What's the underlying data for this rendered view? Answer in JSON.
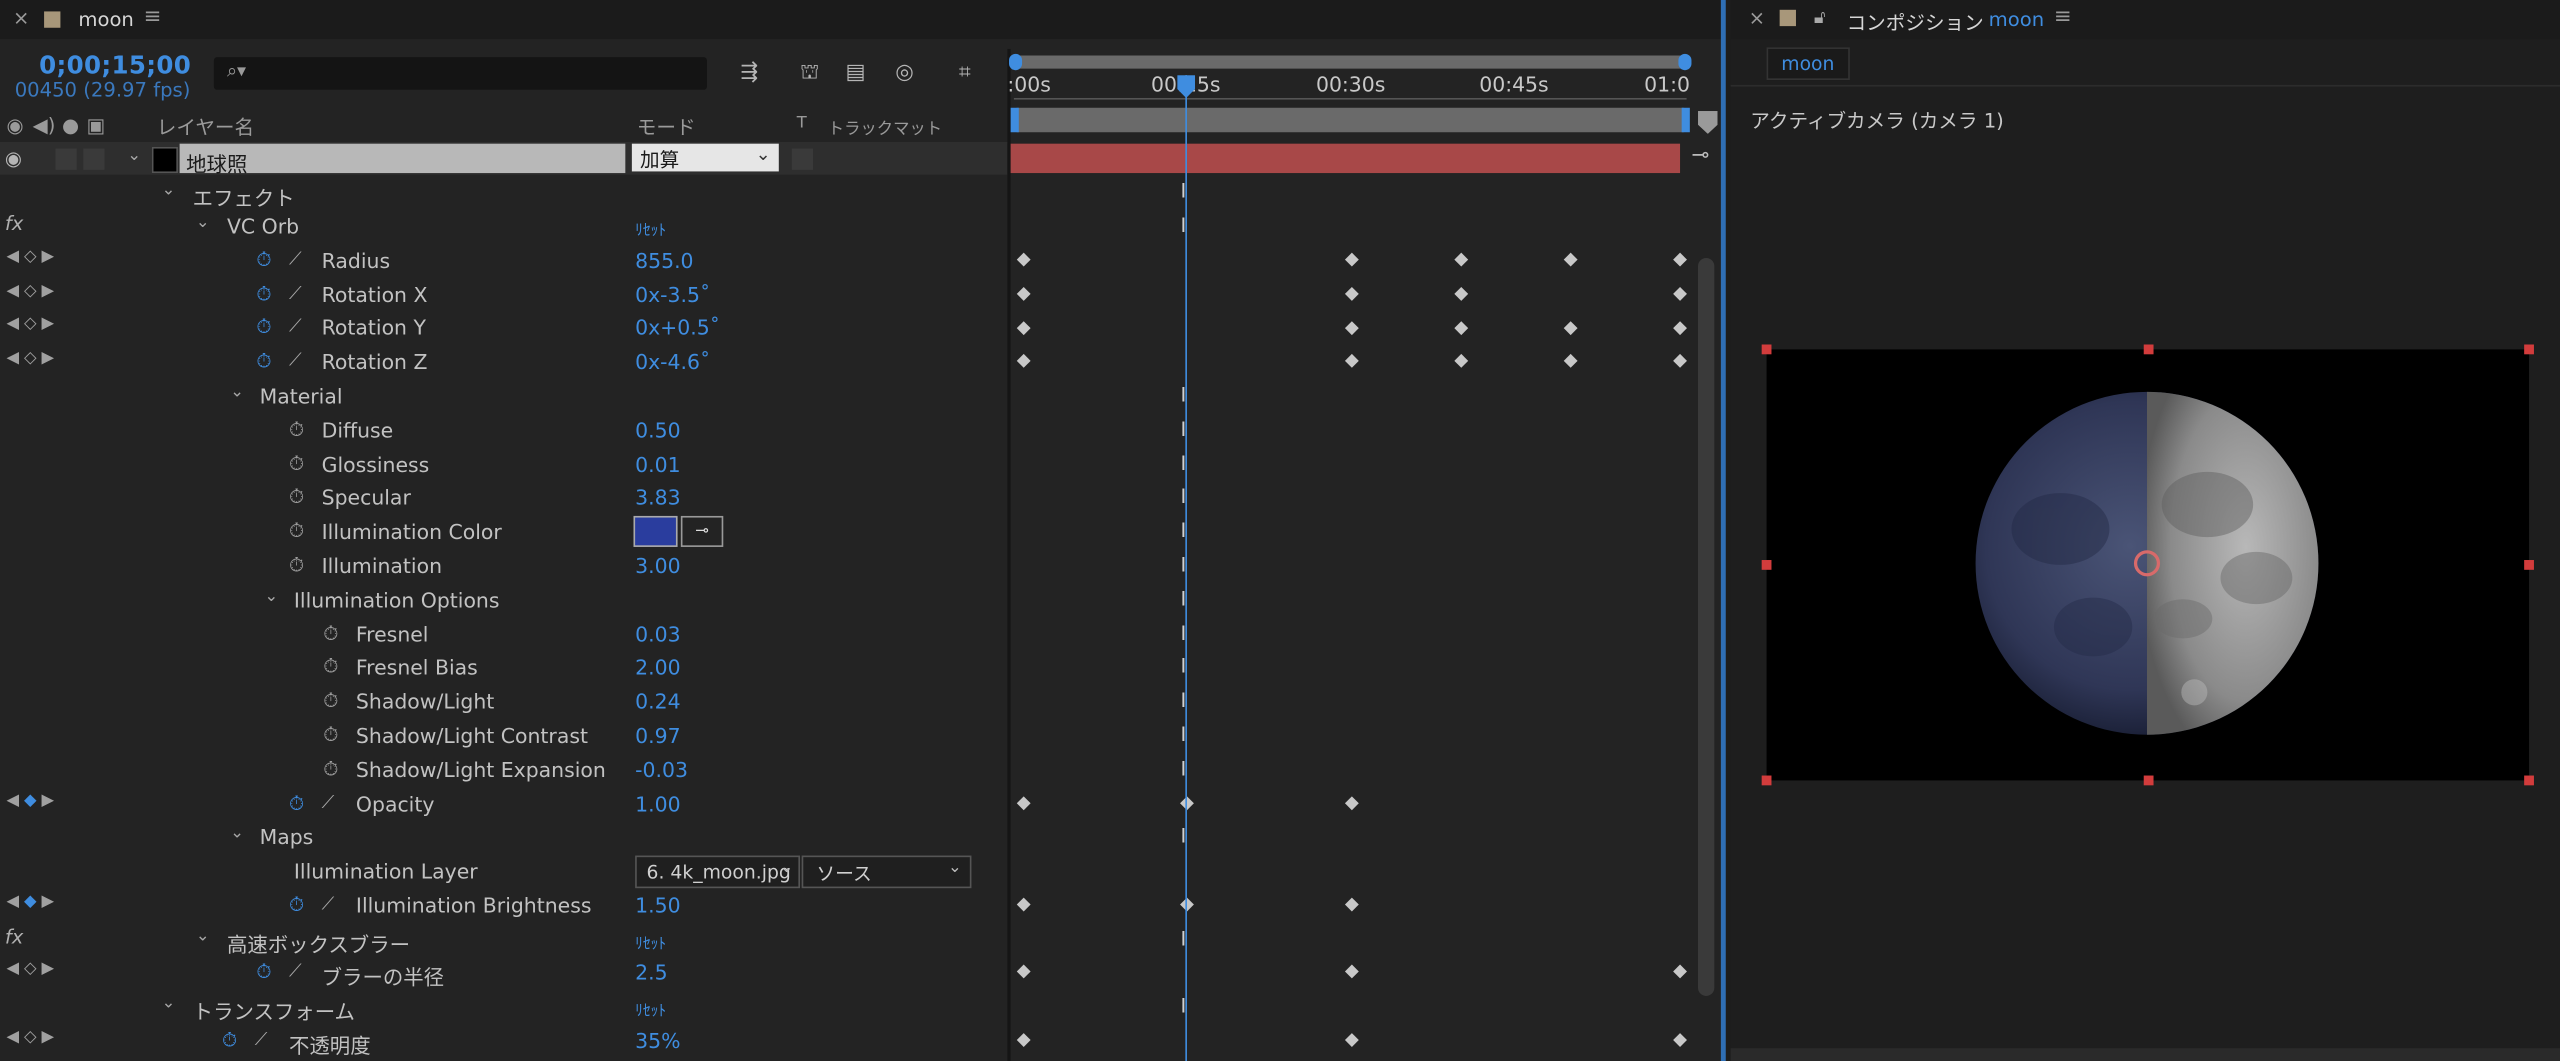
{
  "timeline": {
    "tab": {
      "title": "moon"
    },
    "timecode": "0;00;15;00",
    "frame_info": "00450 (29.97 fps)",
    "columns": {
      "layer_name": "レイヤー名",
      "mode": "モード",
      "t": "T",
      "track_matte": "トラックマット"
    },
    "layer": {
      "name": "地球照",
      "mode": "加算"
    },
    "ruler_ticks": [
      ":00s",
      "00:15s",
      "00:30s",
      "00:45s",
      "01:0"
    ],
    "rows": [
      {
        "label": "エフェクト"
      },
      {
        "label": "VC Orb",
        "reset": "ﾘｾｯﾄ"
      },
      {
        "label": "Radius",
        "value": "855.0"
      },
      {
        "label": "Rotation X",
        "value": "0x-3.5˚"
      },
      {
        "label": "Rotation Y",
        "value": "0x+0.5˚"
      },
      {
        "label": "Rotation Z",
        "value": "0x-4.6˚"
      },
      {
        "label": "Material"
      },
      {
        "label": "Diffuse",
        "value": "0.50"
      },
      {
        "label": "Glossiness",
        "value": "0.01"
      },
      {
        "label": "Specular",
        "value": "3.83"
      },
      {
        "label": "Illumination Color"
      },
      {
        "label": "Illumination",
        "value": "3.00"
      },
      {
        "label": "Illumination Options"
      },
      {
        "label": "Fresnel",
        "value": "0.03"
      },
      {
        "label": "Fresnel Bias",
        "value": "2.00"
      },
      {
        "label": "Shadow/Light",
        "value": "0.24"
      },
      {
        "label": "Shadow/Light Contrast",
        "value": "0.97"
      },
      {
        "label": "Shadow/Light Expansion",
        "value": "-0.03"
      },
      {
        "label": "Opacity",
        "value": "1.00"
      },
      {
        "label": "Maps"
      },
      {
        "label": "Illumination Layer",
        "layer_select": "6. 4k_moon.jpg",
        "source_select": "ソース"
      },
      {
        "label": "Illumination Brightness",
        "value": "1.50"
      },
      {
        "label": "高速ボックスブラー",
        "reset": "ﾘｾｯﾄ"
      },
      {
        "label": "ブラーの半径",
        "value": "2.5"
      },
      {
        "label": "トランスフォーム",
        "reset": "ﾘｾｯﾄ"
      },
      {
        "label": "不透明度",
        "value": "35%"
      }
    ],
    "colors": {
      "accent": "#3f8de0",
      "layer_bar": "#a84848",
      "illumination_color": "#2a3d9e"
    }
  },
  "composition": {
    "tab": {
      "prefix": "コンポジション",
      "name": "moon"
    },
    "chip": "moon",
    "camera_label": "アクティブカメラ (カメラ 1)"
  }
}
